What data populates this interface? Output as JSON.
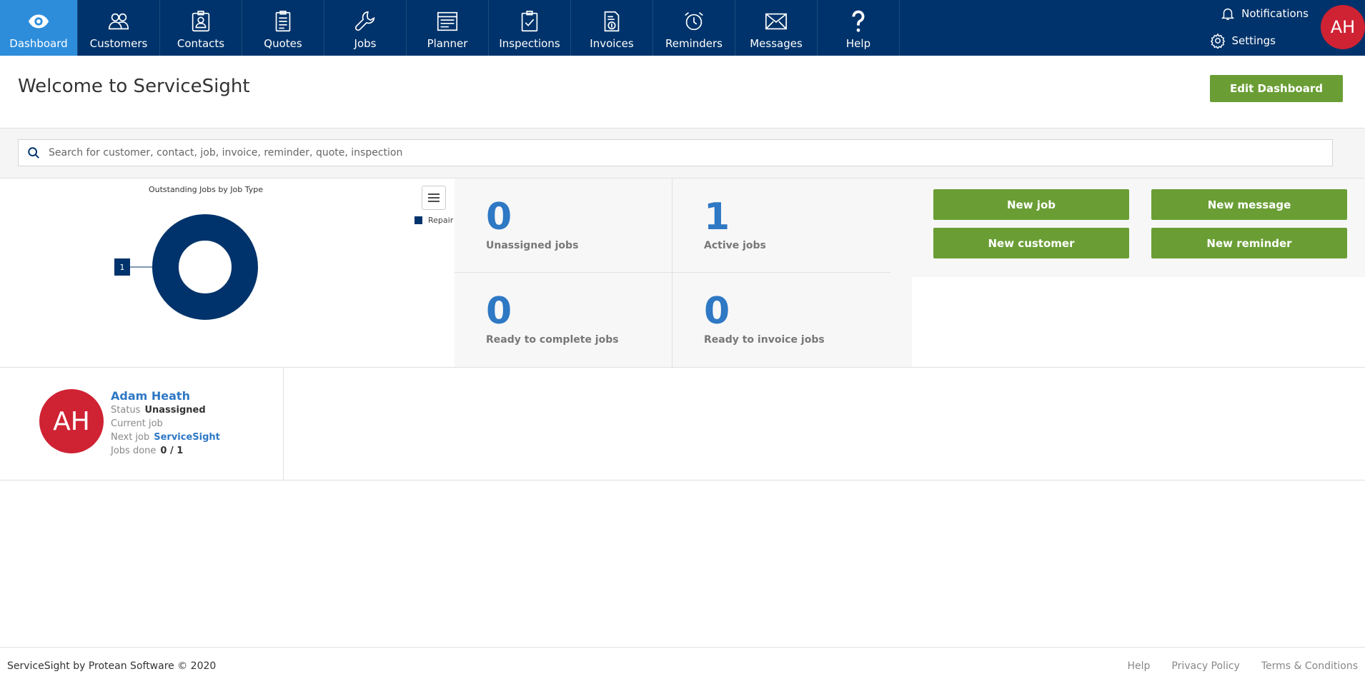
{
  "nav": {
    "items": [
      {
        "label": "Dashboard",
        "icon": "eye-icon",
        "active": true
      },
      {
        "label": "Customers",
        "icon": "users-icon"
      },
      {
        "label": "Contacts",
        "icon": "contact-card-icon"
      },
      {
        "label": "Quotes",
        "icon": "quote-document-icon"
      },
      {
        "label": "Jobs",
        "icon": "wrench-icon"
      },
      {
        "label": "Planner",
        "icon": "calendar-icon"
      },
      {
        "label": "Inspections",
        "icon": "clipboard-check-icon"
      },
      {
        "label": "Invoices",
        "icon": "invoice-icon"
      },
      {
        "label": "Reminders",
        "icon": "alarm-clock-icon"
      },
      {
        "label": "Messages",
        "icon": "envelope-icon"
      },
      {
        "label": "Help",
        "icon": "question-icon"
      }
    ],
    "notifications": "Notifications",
    "settings": "Settings",
    "user_initials": "AH"
  },
  "header": {
    "title": "Welcome to ServiceSight",
    "edit_button": "Edit Dashboard"
  },
  "search": {
    "placeholder": "Search for customer, contact, job, invoice, reminder, quote, inspection"
  },
  "chart_data": {
    "type": "pie",
    "title": "Outstanding Jobs by Job Type",
    "categories": [
      "Repair"
    ],
    "values": [
      1
    ],
    "data_labels": [
      "1"
    ],
    "legend": "right",
    "donut": true,
    "colors": [
      "#00336b"
    ]
  },
  "stats": [
    {
      "value": "0",
      "label": "Unassigned jobs"
    },
    {
      "value": "1",
      "label": "Active jobs"
    },
    {
      "value": "0",
      "label": "Ready to complete jobs"
    },
    {
      "value": "0",
      "label": "Ready to invoice jobs"
    }
  ],
  "actions": {
    "new_job": "New job",
    "new_message": "New message",
    "new_customer": "New customer",
    "new_reminder": "New reminder"
  },
  "technician": {
    "initials": "AH",
    "name": "Adam Heath",
    "status_label": "Status",
    "status": "Unassigned",
    "current_job_label": "Current job",
    "next_job_label": "Next job",
    "next_job": "ServiceSight",
    "jobs_done_label": "Jobs done",
    "jobs_done": "0 / 1"
  },
  "footer": {
    "copyright": "ServiceSight by Protean Software © 2020",
    "links": [
      "Help",
      "Privacy Policy",
      "Terms & Conditions"
    ]
  },
  "colors": {
    "nav_bg": "#00336b",
    "nav_active": "#2d8ddb",
    "accent_green": "#6a9e35",
    "stat_blue": "#2e78c4",
    "avatar_red": "#cf2233"
  }
}
